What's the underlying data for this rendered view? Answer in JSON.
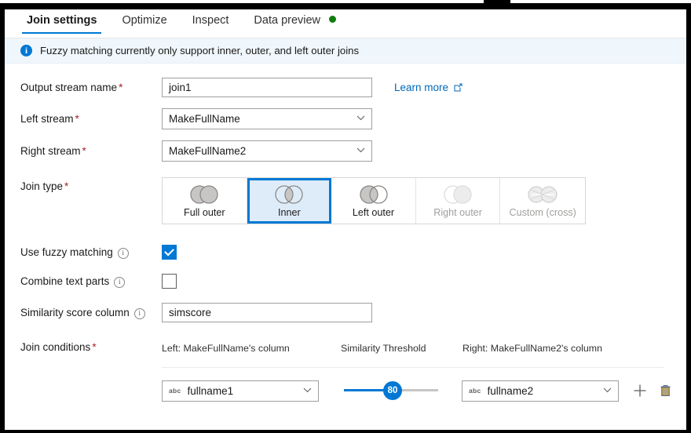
{
  "tabs": [
    {
      "label": "Join settings",
      "active": true,
      "dot": false
    },
    {
      "label": "Optimize",
      "active": false,
      "dot": false
    },
    {
      "label": "Inspect",
      "active": false,
      "dot": false
    },
    {
      "label": "Data preview",
      "active": false,
      "dot": true
    }
  ],
  "info_banner": {
    "icon": "info-icon",
    "text": "Fuzzy matching currently only support inner, outer, and left outer joins"
  },
  "fields": {
    "output_stream": {
      "label": "Output stream name",
      "required": "*",
      "value": "join1"
    },
    "left_stream": {
      "label": "Left stream",
      "required": "*",
      "value": "MakeFullName"
    },
    "right_stream": {
      "label": "Right stream",
      "required": "*",
      "value": "MakeFullName2"
    },
    "learn_more": {
      "label": "Learn more",
      "icon": "external-link-icon"
    }
  },
  "join_type": {
    "label": "Join type",
    "required": "*",
    "selected": "Inner",
    "options": [
      {
        "label": "Full outer",
        "icon": "venn-full-outer-icon",
        "selected": false,
        "disabled": false
      },
      {
        "label": "Inner",
        "icon": "venn-inner-icon",
        "selected": true,
        "disabled": false
      },
      {
        "label": "Left outer",
        "icon": "venn-left-outer-icon",
        "selected": false,
        "disabled": false
      },
      {
        "label": "Right outer",
        "icon": "venn-right-outer-icon",
        "selected": false,
        "disabled": true
      },
      {
        "label": "Custom (cross)",
        "icon": "cross-join-icon",
        "selected": false,
        "disabled": true
      }
    ]
  },
  "fuzzy": {
    "use_fuzzy_matching": {
      "label": "Use fuzzy matching",
      "checked": true,
      "info": "info-circle-icon"
    },
    "combine_text_parts": {
      "label": "Combine text parts",
      "checked": false,
      "info": "info-circle-icon"
    },
    "similarity_score_column": {
      "label": "Similarity score column",
      "info": "info-circle-icon",
      "value": "simscore"
    }
  },
  "join_conditions": {
    "label": "Join conditions",
    "required": "*",
    "columns": {
      "left": "Left: MakeFullName's column",
      "middle": "Similarity Threshold",
      "right": "Right: MakeFullName2's column"
    },
    "rows": [
      {
        "left_column": {
          "type_icon": "abc",
          "value": "fullname1"
        },
        "threshold": {
          "value": 80,
          "min": 0,
          "max": 100
        },
        "right_column": {
          "type_icon": "abc",
          "value": "fullname2"
        },
        "add_icon": "plus-icon",
        "delete_icon": "trash-icon"
      }
    ]
  },
  "colors": {
    "accent": "#0078d4",
    "accent_link": "#0067b8",
    "selected_bg": "#deecf9",
    "info_bg": "#eff6fc",
    "required": "#a4262c",
    "status_dot": "#107c10",
    "track": "#c8c6c4"
  }
}
